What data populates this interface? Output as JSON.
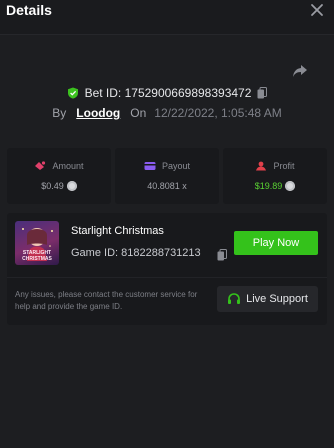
{
  "header": {
    "title": "Details",
    "close_icon": "close-icon"
  },
  "bet": {
    "id_text": "Bet ID: 1752900669898393472",
    "by_label": "By",
    "username": "Loodog",
    "on_label": "On",
    "datetime": "12/22/2022, 1:05:48 AM"
  },
  "stats": {
    "amount": {
      "label": "Amount",
      "value": "$0.49",
      "icon": "amount-icon"
    },
    "payout": {
      "label": "Payout",
      "value": "40.8081 x",
      "icon": "payout-icon"
    },
    "profit": {
      "label": "Profit",
      "value": "$19.89",
      "icon": "profit-icon"
    }
  },
  "game": {
    "name": "Starlight Christmas",
    "id_text": "Game ID: 8182288731213",
    "thumb_text": "STARLIGHT CHRISTMAS",
    "play_label": "Play Now"
  },
  "support": {
    "text": "Any issues, please contact the customer service for help and provide the game ID.",
    "button_label": "Live Support"
  },
  "colors": {
    "background": "#1d1e21",
    "accent_green": "#34c21b",
    "profit_green": "#5ad233",
    "amount_pink": "#e0406a",
    "payout_purple": "#8a5cf0",
    "profit_red": "#e0404a"
  }
}
